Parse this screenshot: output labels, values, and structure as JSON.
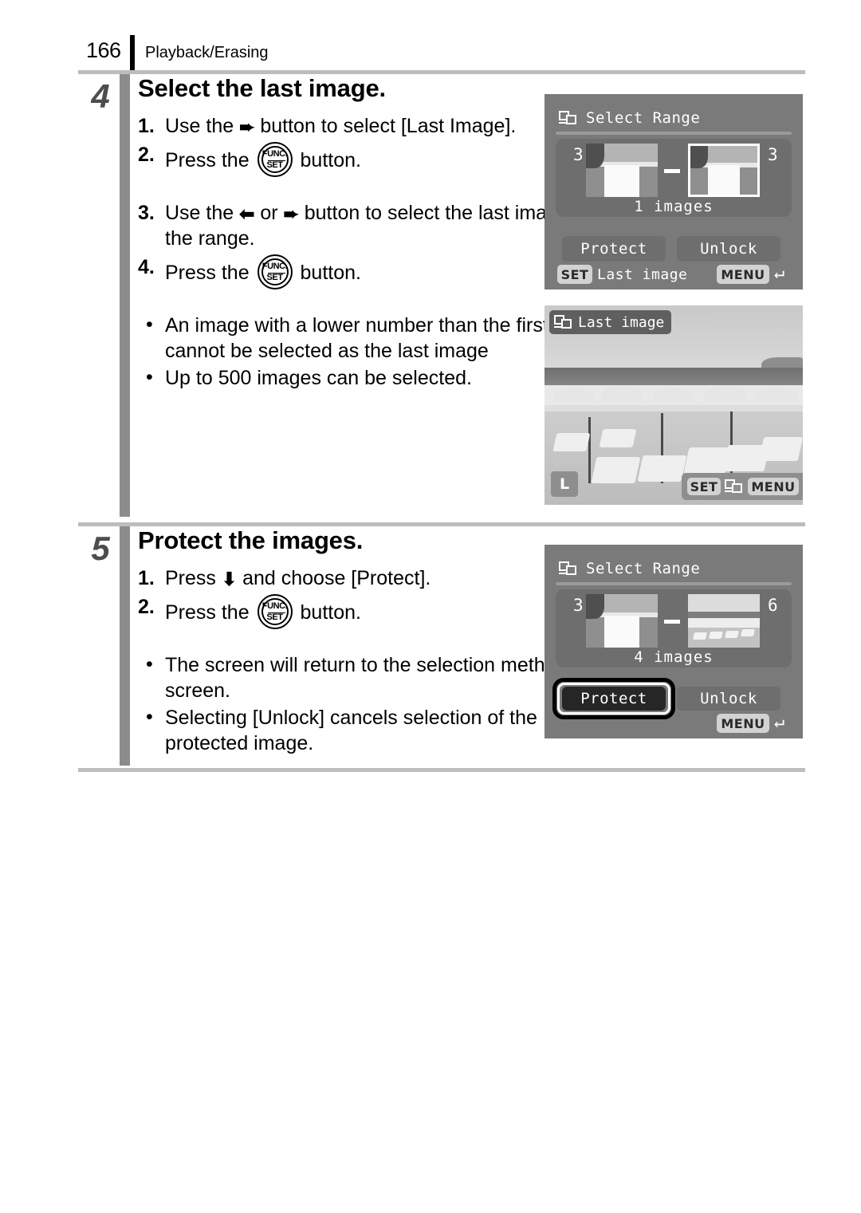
{
  "page": {
    "number": "166",
    "section_title": "Playback/Erasing"
  },
  "steps": [
    {
      "number": "4",
      "title": "Select the last image.",
      "instructions": [
        {
          "mark": "1.",
          "pre": "Use the ",
          "icon": "right-arrow",
          "post": " button to select [Last Image]."
        },
        {
          "mark": "2.",
          "pre": "Press the ",
          "icon": "func-set",
          "post": " button."
        },
        {
          "mark": "3.",
          "pre": "Use the ",
          "icon": "left-arrow",
          "mid": " or ",
          "icon2": "right-arrow",
          "post": " button to select the last image in the range."
        },
        {
          "mark": "4.",
          "pre": "Press the ",
          "icon": "func-set",
          "post": " button."
        }
      ],
      "bullets": [
        "An image with a lower number than the first image cannot be selected as the last image",
        "Up to 500 images can be selected."
      ]
    },
    {
      "number": "5",
      "title": "Protect the images.",
      "instructions": [
        {
          "mark": "1.",
          "pre": "Press ",
          "icon": "down-arrow",
          "post": " and choose [Protect]."
        },
        {
          "mark": "2.",
          "pre": "Press the ",
          "icon": "func-set",
          "post": " button."
        }
      ],
      "bullets": [
        "The screen will return to the selection method screen.",
        "Selecting [Unlock] cancels selection of the protected image."
      ]
    }
  ],
  "screens": {
    "select_range_first": {
      "title": "Select Range",
      "title_icon": "select-range-icon",
      "first_number": "3",
      "last_number": "3",
      "count_label": "1 images",
      "protect_label": "Protect",
      "unlock_label": "Unlock",
      "set_badge": "SET",
      "set_action": "Last image",
      "menu_badge": "MENU",
      "return_icon": "return-arrow-icon"
    },
    "last_image": {
      "title": "Last image",
      "title_icon": "select-range-icon",
      "quality_badge": "L",
      "set_badge": "SET",
      "set_icon": "select-range-icon",
      "menu_badge": "MENU",
      "return_icon": "return-arrow-icon"
    },
    "select_range_protect": {
      "title": "Select Range",
      "title_icon": "select-range-icon",
      "first_number": "3",
      "last_number": "6",
      "count_label": "4 images",
      "protect_label": "Protect",
      "unlock_label": "Unlock",
      "menu_badge": "MENU",
      "return_icon": "return-arrow-icon"
    }
  },
  "colors": {
    "screen_bg": "#7a7a7a",
    "panel_bg": "#6e6e6e",
    "badge_bg": "#d2d2d2",
    "rule": "#bdbdbd",
    "step_bar": "#8c8c8c",
    "step_number": "#4d4d4d"
  }
}
